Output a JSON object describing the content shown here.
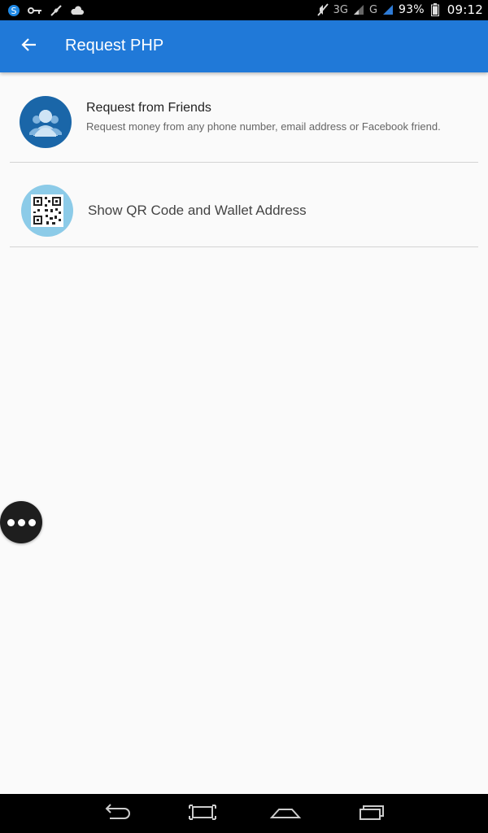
{
  "status_bar": {
    "network_label": "3G",
    "network_label_2": "G",
    "battery": "93%",
    "time": "09:12",
    "icons": [
      "skype-icon",
      "key-icon",
      "satellite-icon",
      "cloud-icon",
      "mute-icon",
      "signal-icon",
      "battery-icon"
    ]
  },
  "app_bar": {
    "title": "Request PHP",
    "color": "#2079d8"
  },
  "options": [
    {
      "title": "Request from Friends",
      "subtitle": "Request money from any phone number, email address or Facebook friend.",
      "icon": "friends-icon"
    },
    {
      "title": "Show QR Code and Wallet Address",
      "icon": "qr-code-icon"
    }
  ],
  "nav_bar": {
    "buttons": [
      "back-icon",
      "screenshot-icon",
      "home-icon",
      "recent-apps-icon"
    ]
  }
}
